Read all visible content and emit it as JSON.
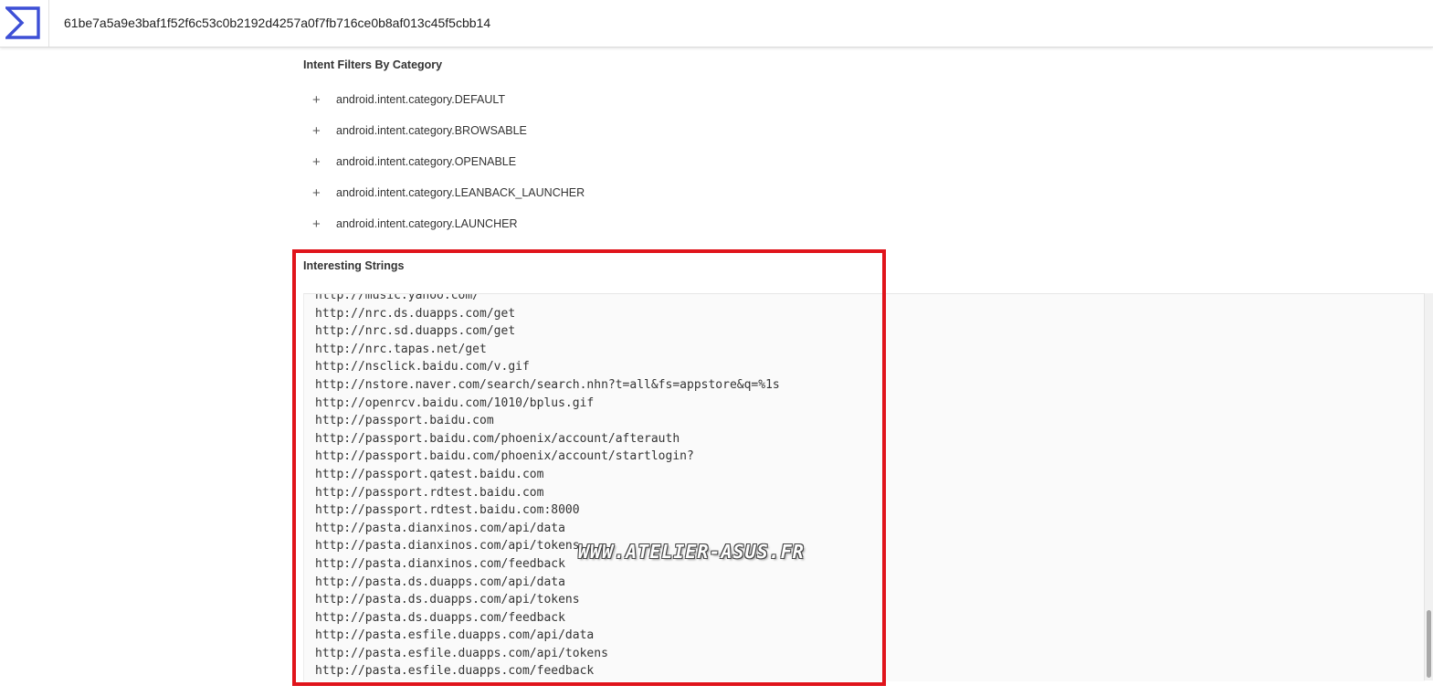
{
  "header": {
    "logo_icon": "sigma-logo-icon",
    "hash_value": "61be7a5a9e3baf1f52f6c53c0b2192d4257a0f7fb716ce0b8af013c45f5cbb14",
    "accent_color": "#3d4fd6"
  },
  "intent_filters": {
    "title": "Intent Filters By Category",
    "items": [
      {
        "icon": "plus",
        "label": "android.intent.category.DEFAULT"
      },
      {
        "icon": "plus",
        "label": "android.intent.category.BROWSABLE"
      },
      {
        "icon": "plus",
        "label": "android.intent.category.OPENABLE"
      },
      {
        "icon": "plus",
        "label": "android.intent.category.LEANBACK_LAUNCHER"
      },
      {
        "icon": "plus",
        "label": "android.intent.category.LAUNCHER"
      }
    ]
  },
  "interesting_strings": {
    "title": "Interesting Strings",
    "lines": [
      "http://music.yahoo.com/",
      "http://nrc.ds.duapps.com/get",
      "http://nrc.sd.duapps.com/get",
      "http://nrc.tapas.net/get",
      "http://nsclick.baidu.com/v.gif",
      "http://nstore.naver.com/search/search.nhn?t=all&fs=appstore&q=%1s",
      "http://openrcv.baidu.com/1010/bplus.gif",
      "http://passport.baidu.com",
      "http://passport.baidu.com/phoenix/account/afterauth",
      "http://passport.baidu.com/phoenix/account/startlogin?",
      "http://passport.qatest.baidu.com",
      "http://passport.rdtest.baidu.com",
      "http://passport.rdtest.baidu.com:8000",
      "http://pasta.dianxinos.com/api/data",
      "http://pasta.dianxinos.com/api/tokens",
      "http://pasta.dianxinos.com/feedback",
      "http://pasta.ds.duapps.com/api/data",
      "http://pasta.ds.duapps.com/api/tokens",
      "http://pasta.ds.duapps.com/feedback",
      "http://pasta.esfile.duapps.com/api/data",
      "http://pasta.esfile.duapps.com/api/tokens",
      "http://pasta.esfile.duapps.com/feedback"
    ]
  },
  "highlight_color": "#e0141b",
  "watermark": "WWW.ATELIER-ASUS.FR"
}
